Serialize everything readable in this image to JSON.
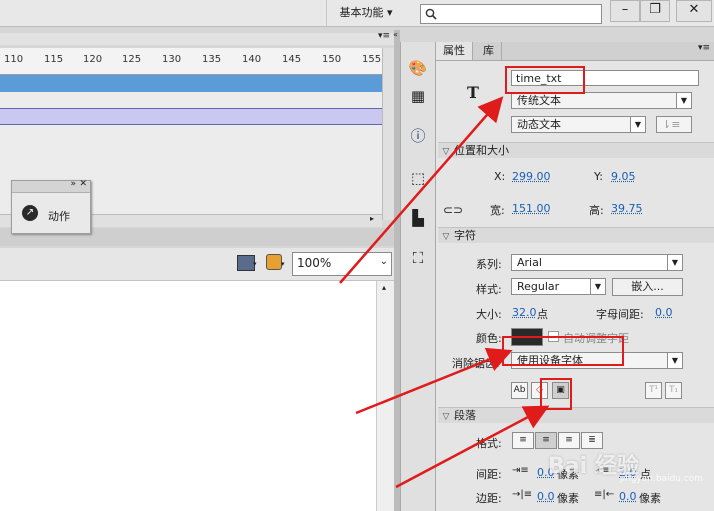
{
  "topbar": {
    "workspace_label": "基本功能",
    "workspace_arrow": "▾",
    "search_value": ""
  },
  "window": {
    "minimize": "–",
    "restore": "❐",
    "close": "✕"
  },
  "timeline": {
    "ticks": [
      "110",
      "115",
      "120",
      "125",
      "130",
      "135",
      "140",
      "145",
      "150",
      "155"
    ]
  },
  "actions_panel": {
    "label": "动作"
  },
  "stage": {
    "zoom": "100%"
  },
  "properties": {
    "tabs": [
      "属性",
      "库"
    ],
    "instance_name": "time_txt",
    "text_engine": "传统文本",
    "text_type": "动态文本",
    "sections": {
      "position": "位置和大小",
      "character": "字符",
      "paragraph": "段落"
    },
    "position": {
      "x_label": "X:",
      "x": "299.00",
      "y_label": "Y:",
      "y": "9.05",
      "w_label": "宽:",
      "w": "151.00",
      "h_label": "高:",
      "h": "39.75"
    },
    "character": {
      "family_label": "系列:",
      "family": "Arial",
      "style_label": "样式:",
      "style": "Regular",
      "embed_button": "嵌入...",
      "size_label": "大小:",
      "size": "32.0",
      "size_unit": "点",
      "spacing_label": "字母间距:",
      "spacing": "0.0",
      "color_label": "颜色:",
      "color": "#2a2a2a",
      "autokern_label": "自动调整字距",
      "antialias_label": "消除锯齿:",
      "antialias": "使用设备字体"
    },
    "paragraph": {
      "format_label": "格式:",
      "spacing_label": "间距:",
      "indent": "0.0",
      "indent_unit": "像素",
      "leading": "2.0",
      "leading_unit": "点",
      "margin_label": "边距:",
      "left_margin": "0.0",
      "left_unit": "像素",
      "right_margin": "0.0",
      "right_unit": "像素"
    }
  },
  "watermark": {
    "brand": "Bai 经验",
    "sub": "jingyan.baidu.com"
  },
  "colors": {
    "annotation_red": "#e01b1b",
    "timeline_blue": "#5b9bd8"
  }
}
